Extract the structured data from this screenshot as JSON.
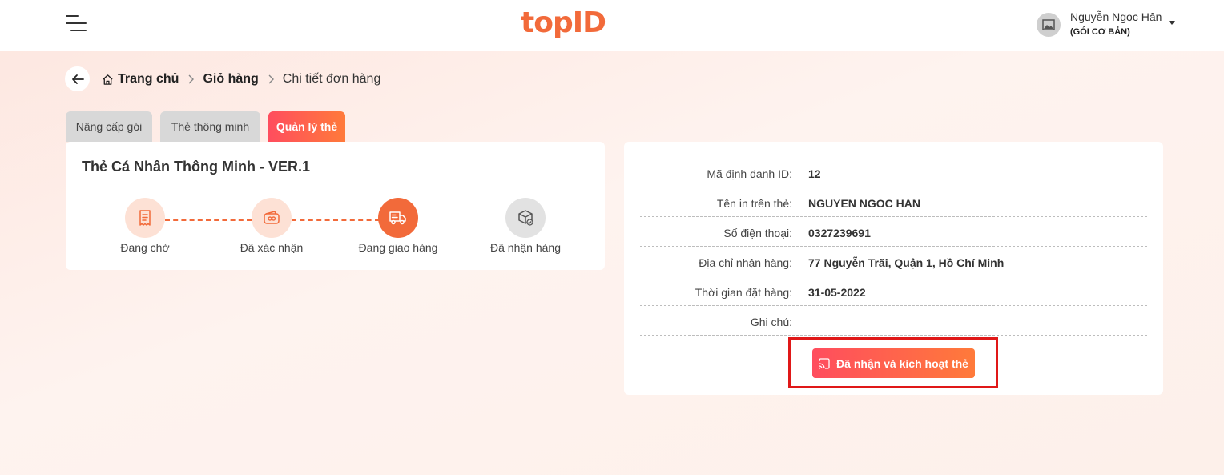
{
  "header": {
    "logo_text": "topID",
    "user_name": "Nguyễn Ngọc Hân",
    "user_plan": "(GÓI CƠ BẢN)"
  },
  "breadcrumb": {
    "home": "Trang chủ",
    "cart": "Giỏ hàng",
    "current": "Chi tiết đơn hàng"
  },
  "tabs": [
    {
      "label": "Nâng cấp gói",
      "active": false
    },
    {
      "label": "Thẻ thông minh",
      "active": false
    },
    {
      "label": "Quản lý thẻ",
      "active": true
    }
  ],
  "order_status": {
    "title": "Thẻ Cá Nhân Thông Minh - VER.1",
    "steps": [
      {
        "label": "Đang chờ",
        "icon": "receipt-icon",
        "state": "done"
      },
      {
        "label": "Đã xác nhận",
        "icon": "wallet-icon",
        "state": "done"
      },
      {
        "label": "Đang giao hàng",
        "icon": "delivery-truck-icon",
        "state": "current"
      },
      {
        "label": "Đã nhận hàng",
        "icon": "package-check-icon",
        "state": "todo"
      }
    ]
  },
  "order_info": {
    "rows": [
      {
        "label": "Mã định danh ID:",
        "value": "12"
      },
      {
        "label": "Tên in trên thẻ:",
        "value": "NGUYEN NGOC HAN"
      },
      {
        "label": "Số điện thoại:",
        "value": "0327239691"
      },
      {
        "label": "Địa chỉ nhận hàng:",
        "value": "77 Nguyễn Trãi,  Quận 1, Hồ Chí Minh"
      },
      {
        "label": "Thời gian đặt hàng:",
        "value": "31-05-2022"
      },
      {
        "label": "Ghi chú:",
        "value": ""
      }
    ],
    "activate_button": "Đã nhận và kích hoạt thẻ"
  },
  "colors": {
    "accent": "#f26a3a",
    "gradient_start": "#ff4d5e",
    "gradient_end": "#ff7a3a",
    "highlight": "#e01818"
  }
}
